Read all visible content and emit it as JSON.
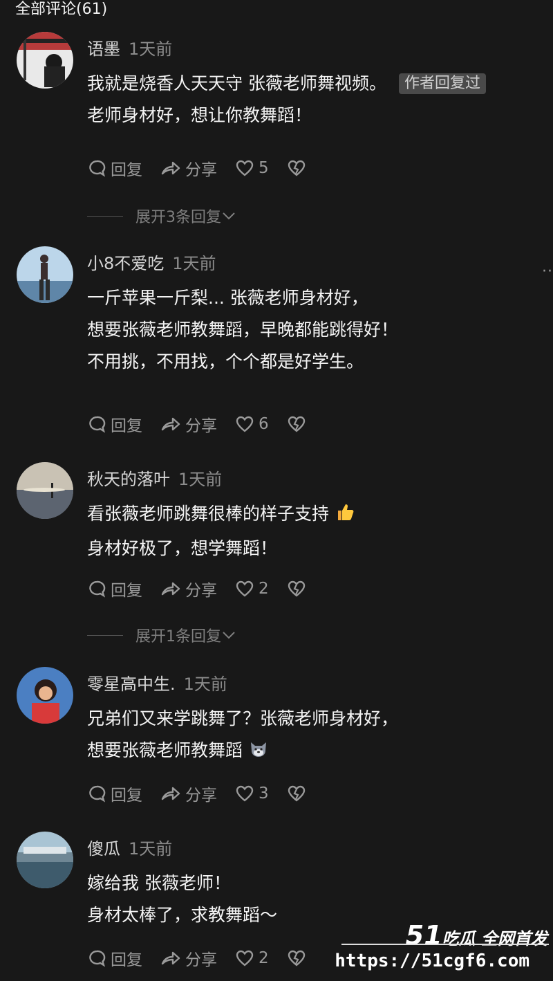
{
  "header": {
    "title": "全部评论(61)"
  },
  "action_labels": {
    "reply": "回复",
    "share": "分享"
  },
  "comments": [
    {
      "user": "语墨",
      "time": "1天前",
      "lines": [
        "我就是烧香人天天守 张薇老师舞视频。",
        "老师身材好，想让你教舞蹈！"
      ],
      "badge": "作者回复过",
      "likes": "5",
      "expand": "展开3条回复"
    },
    {
      "user": "小8不爱吃",
      "time": "1天前",
      "lines": [
        "一斤苹果一斤梨... 张薇老师身材好，",
        "想要张薇老师教舞蹈，早晚都能跳得好！",
        "不用挑，不用找，个个都是好学生。"
      ],
      "likes": "6"
    },
    {
      "user": "秋天的落叶",
      "time": "1天前",
      "lines": [
        "看张薇老师跳舞很棒的样子支持",
        "身材好极了，想学舞蹈！"
      ],
      "emoji": "thumbs-up-emoji",
      "likes": "2",
      "expand": "展开1条回复"
    },
    {
      "user": "零星高中生.",
      "time": "1天前",
      "lines": [
        "兄弟们又来学跳舞了？张薇老师身材好，",
        "想要张薇老师教舞蹈"
      ],
      "emoji": "dog-emoji",
      "likes": "3"
    },
    {
      "user": "傻瓜",
      "time": "1天前",
      "lines": [
        "嫁给我 张薇老师！",
        "身材太棒了，求教舞蹈～"
      ],
      "likes": "2"
    }
  ],
  "watermark": {
    "brand_number": "51",
    "brand_text": "吃瓜 全网首发",
    "url": "https://51cgf6.com"
  },
  "icons": [
    "comment-bubble-icon",
    "share-arrow-icon",
    "heart-icon",
    "broken-heart-icon",
    "chevron-down-icon",
    "more-icon"
  ],
  "colors": {
    "background": "#181818",
    "text": "#f4f4f4",
    "muted": "#9a9a9a",
    "badge": "#4a4a4a"
  }
}
